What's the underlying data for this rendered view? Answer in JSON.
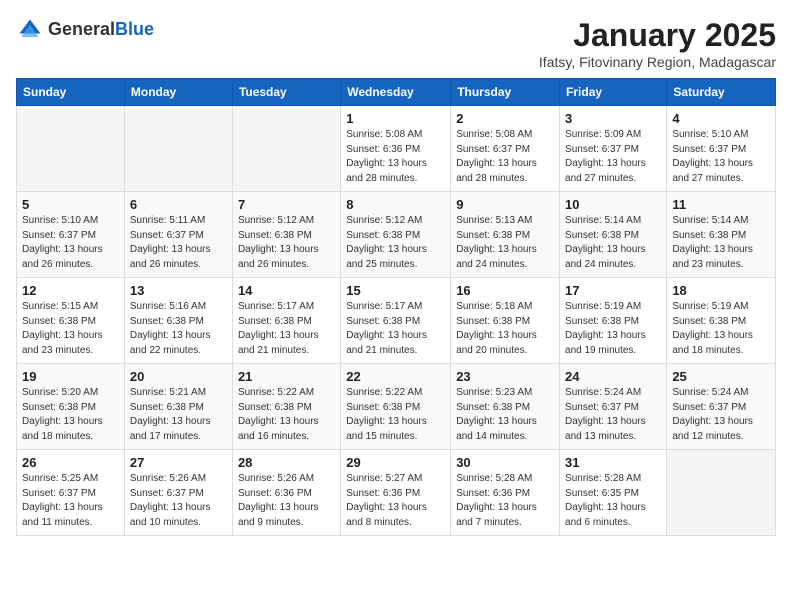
{
  "logo": {
    "general": "General",
    "blue": "Blue"
  },
  "header": {
    "title": "January 2025",
    "subtitle": "Ifatsy, Fitovinany Region, Madagascar"
  },
  "weekdays": [
    "Sunday",
    "Monday",
    "Tuesday",
    "Wednesday",
    "Thursday",
    "Friday",
    "Saturday"
  ],
  "weeks": [
    [
      null,
      null,
      null,
      {
        "day": "1",
        "sunrise": "5:08 AM",
        "sunset": "6:36 PM",
        "daylight": "13 hours and 28 minutes."
      },
      {
        "day": "2",
        "sunrise": "5:08 AM",
        "sunset": "6:37 PM",
        "daylight": "13 hours and 28 minutes."
      },
      {
        "day": "3",
        "sunrise": "5:09 AM",
        "sunset": "6:37 PM",
        "daylight": "13 hours and 27 minutes."
      },
      {
        "day": "4",
        "sunrise": "5:10 AM",
        "sunset": "6:37 PM",
        "daylight": "13 hours and 27 minutes."
      }
    ],
    [
      {
        "day": "5",
        "sunrise": "5:10 AM",
        "sunset": "6:37 PM",
        "daylight": "13 hours and 26 minutes."
      },
      {
        "day": "6",
        "sunrise": "5:11 AM",
        "sunset": "6:37 PM",
        "daylight": "13 hours and 26 minutes."
      },
      {
        "day": "7",
        "sunrise": "5:12 AM",
        "sunset": "6:38 PM",
        "daylight": "13 hours and 26 minutes."
      },
      {
        "day": "8",
        "sunrise": "5:12 AM",
        "sunset": "6:38 PM",
        "daylight": "13 hours and 25 minutes."
      },
      {
        "day": "9",
        "sunrise": "5:13 AM",
        "sunset": "6:38 PM",
        "daylight": "13 hours and 24 minutes."
      },
      {
        "day": "10",
        "sunrise": "5:14 AM",
        "sunset": "6:38 PM",
        "daylight": "13 hours and 24 minutes."
      },
      {
        "day": "11",
        "sunrise": "5:14 AM",
        "sunset": "6:38 PM",
        "daylight": "13 hours and 23 minutes."
      }
    ],
    [
      {
        "day": "12",
        "sunrise": "5:15 AM",
        "sunset": "6:38 PM",
        "daylight": "13 hours and 23 minutes."
      },
      {
        "day": "13",
        "sunrise": "5:16 AM",
        "sunset": "6:38 PM",
        "daylight": "13 hours and 22 minutes."
      },
      {
        "day": "14",
        "sunrise": "5:17 AM",
        "sunset": "6:38 PM",
        "daylight": "13 hours and 21 minutes."
      },
      {
        "day": "15",
        "sunrise": "5:17 AM",
        "sunset": "6:38 PM",
        "daylight": "13 hours and 21 minutes."
      },
      {
        "day": "16",
        "sunrise": "5:18 AM",
        "sunset": "6:38 PM",
        "daylight": "13 hours and 20 minutes."
      },
      {
        "day": "17",
        "sunrise": "5:19 AM",
        "sunset": "6:38 PM",
        "daylight": "13 hours and 19 minutes."
      },
      {
        "day": "18",
        "sunrise": "5:19 AM",
        "sunset": "6:38 PM",
        "daylight": "13 hours and 18 minutes."
      }
    ],
    [
      {
        "day": "19",
        "sunrise": "5:20 AM",
        "sunset": "6:38 PM",
        "daylight": "13 hours and 18 minutes."
      },
      {
        "day": "20",
        "sunrise": "5:21 AM",
        "sunset": "6:38 PM",
        "daylight": "13 hours and 17 minutes."
      },
      {
        "day": "21",
        "sunrise": "5:22 AM",
        "sunset": "6:38 PM",
        "daylight": "13 hours and 16 minutes."
      },
      {
        "day": "22",
        "sunrise": "5:22 AM",
        "sunset": "6:38 PM",
        "daylight": "13 hours and 15 minutes."
      },
      {
        "day": "23",
        "sunrise": "5:23 AM",
        "sunset": "6:38 PM",
        "daylight": "13 hours and 14 minutes."
      },
      {
        "day": "24",
        "sunrise": "5:24 AM",
        "sunset": "6:37 PM",
        "daylight": "13 hours and 13 minutes."
      },
      {
        "day": "25",
        "sunrise": "5:24 AM",
        "sunset": "6:37 PM",
        "daylight": "13 hours and 12 minutes."
      }
    ],
    [
      {
        "day": "26",
        "sunrise": "5:25 AM",
        "sunset": "6:37 PM",
        "daylight": "13 hours and 11 minutes."
      },
      {
        "day": "27",
        "sunrise": "5:26 AM",
        "sunset": "6:37 PM",
        "daylight": "13 hours and 10 minutes."
      },
      {
        "day": "28",
        "sunrise": "5:26 AM",
        "sunset": "6:36 PM",
        "daylight": "13 hours and 9 minutes."
      },
      {
        "day": "29",
        "sunrise": "5:27 AM",
        "sunset": "6:36 PM",
        "daylight": "13 hours and 8 minutes."
      },
      {
        "day": "30",
        "sunrise": "5:28 AM",
        "sunset": "6:36 PM",
        "daylight": "13 hours and 7 minutes."
      },
      {
        "day": "31",
        "sunrise": "5:28 AM",
        "sunset": "6:35 PM",
        "daylight": "13 hours and 6 minutes."
      },
      null
    ]
  ],
  "labels": {
    "sunrise": "Sunrise:",
    "sunset": "Sunset:",
    "daylight": "Daylight:"
  }
}
